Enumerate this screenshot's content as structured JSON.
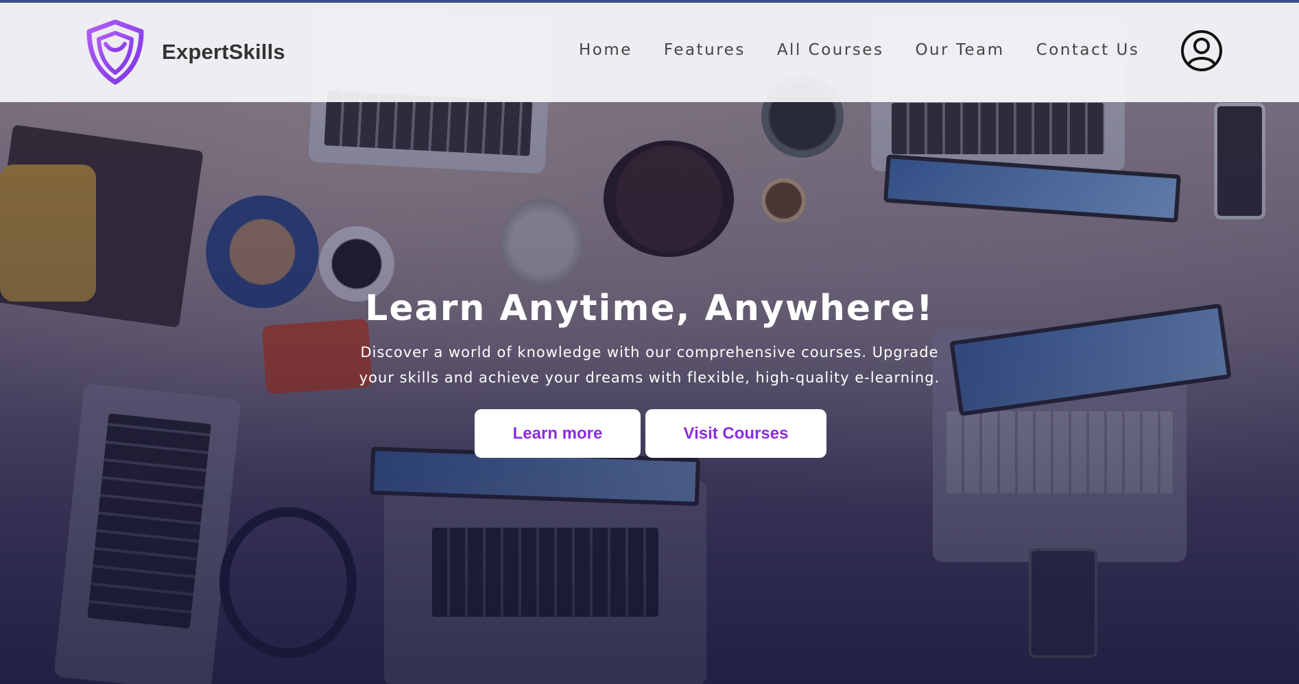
{
  "brand": {
    "name": "ExpertSkills",
    "logo_icon": "shield-logo-icon",
    "accent_color": "#8b3df0"
  },
  "nav": {
    "items": [
      {
        "label": "Home"
      },
      {
        "label": "Features"
      },
      {
        "label": "All Courses"
      },
      {
        "label": "Our Team"
      },
      {
        "label": "Contact Us"
      }
    ],
    "profile_icon": "user-circle-icon"
  },
  "hero": {
    "headline": "Learn Anytime, Anywhere!",
    "subtext_line1": "Discover a world of knowledge with our comprehensive courses. Upgrade",
    "subtext_line2": "your skills and achieve your dreams with flexible, high-quality e-learning.",
    "buttons": {
      "learn_more": "Learn more",
      "visit_courses": "Visit Courses"
    },
    "button_text_color": "#8b2be2"
  }
}
